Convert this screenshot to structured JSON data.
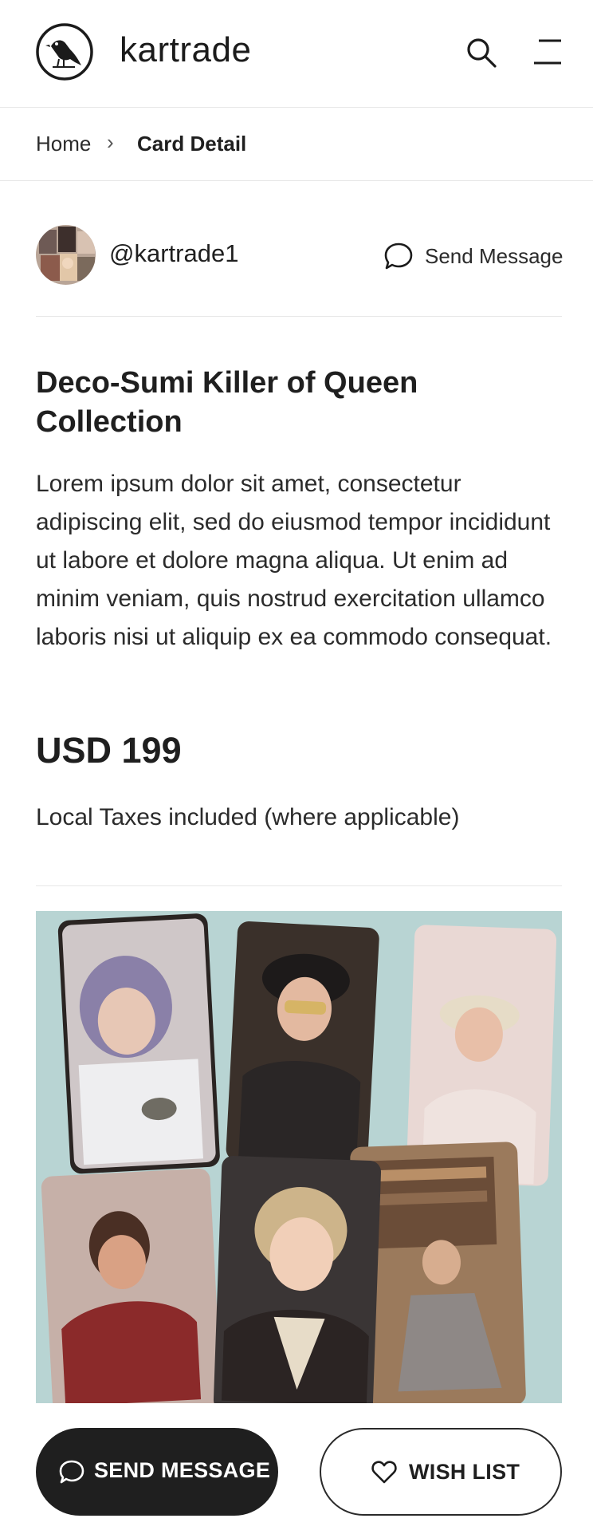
{
  "header": {
    "brand": "kartrade",
    "logo_icon": "magpie-logo-icon",
    "search_icon": "search-icon",
    "menu_icon": "menu-icon"
  },
  "breadcrumb": {
    "home": "Home",
    "separator": "›",
    "current": "Card Detail"
  },
  "seller": {
    "username": "@kartrade1",
    "send_message_label": "Send Message",
    "message_icon": "chat-bubble-icon"
  },
  "product": {
    "title": "Deco-Sumi Killer of Queen Collection",
    "description": "Lorem ipsum dolor sit amet, consectetur adipiscing elit, sed do eiusmod tempor incididunt ut labore et dolore magna aliqua. Ut enim ad minim veniam, quis nostrud exercitation ullamco laboris nisi ut aliquip ex ea commodo consequat.",
    "price": "USD 199",
    "tax_note": "Local Taxes included (where applicable)"
  },
  "actions": {
    "send_message": "SEND MESSAGE",
    "wish_list": "WISH LIST"
  },
  "colors": {
    "primary_dark": "#1f1f1f",
    "divider": "#e6e6e6",
    "photo_background": "#b5d3d3"
  }
}
